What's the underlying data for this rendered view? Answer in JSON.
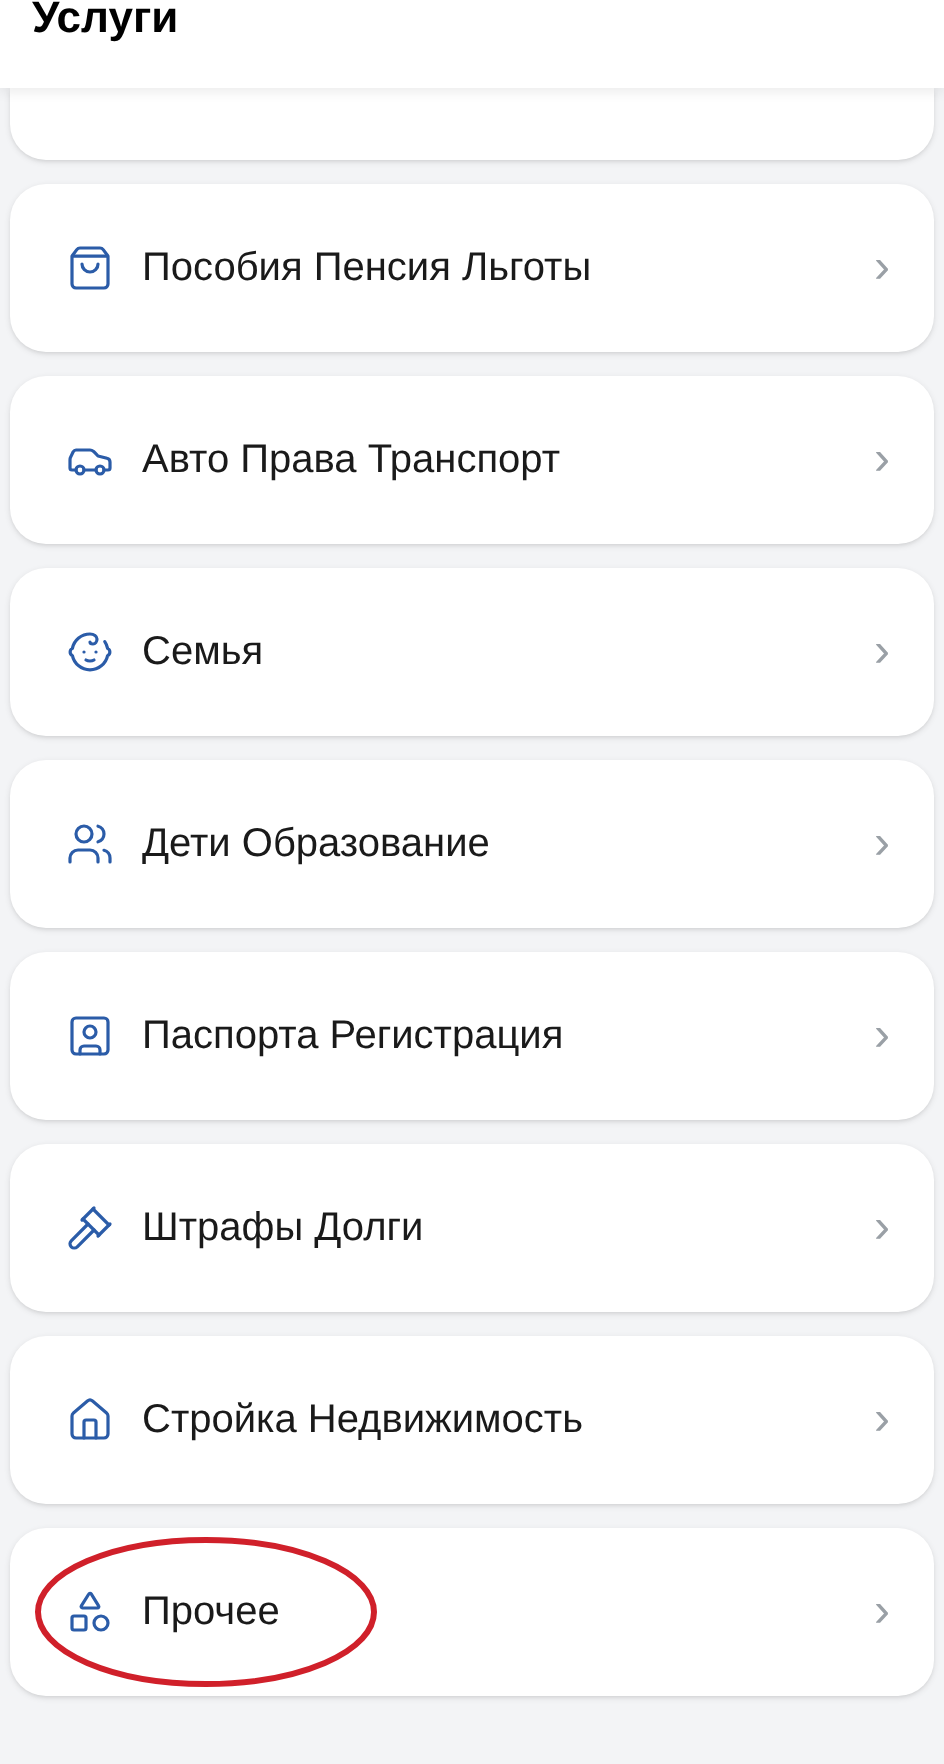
{
  "header": {
    "title": "Услуги"
  },
  "items": [
    {
      "kind": "purse",
      "label": "Пособия Пенсия Льготы",
      "chevron": "›",
      "highlighted": false
    },
    {
      "kind": "car",
      "label": "Авто Права Транспорт",
      "chevron": "›",
      "highlighted": false
    },
    {
      "kind": "stroller",
      "label": "Семья",
      "chevron": "›",
      "highlighted": false
    },
    {
      "kind": "family",
      "label": "Дети Образование",
      "chevron": "›",
      "highlighted": false
    },
    {
      "kind": "passport",
      "label": "Паспорта Регистрация",
      "chevron": "›",
      "highlighted": false
    },
    {
      "kind": "gavel",
      "label": "Штрафы Долги",
      "chevron": "›",
      "highlighted": false
    },
    {
      "kind": "house",
      "label": "Стройка Недвижимость",
      "chevron": "›",
      "highlighted": false
    },
    {
      "kind": "grid",
      "label": "Прочее",
      "chevron": "›",
      "highlighted": true
    }
  ]
}
